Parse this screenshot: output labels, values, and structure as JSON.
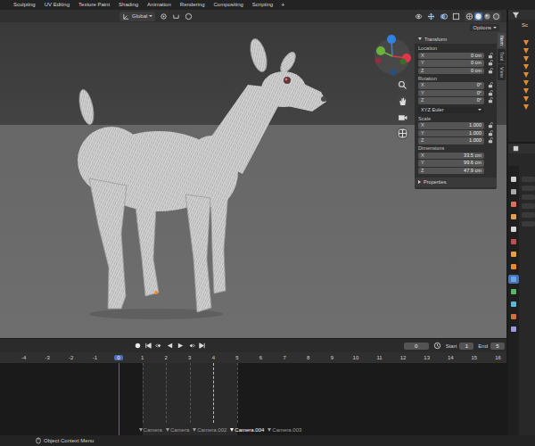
{
  "workspace_tabs": [
    {
      "label": "Sculpting",
      "selected": false
    },
    {
      "label": "UV Editing",
      "selected": false
    },
    {
      "label": "Texture Paint",
      "selected": false
    },
    {
      "label": "Shading",
      "selected": false
    },
    {
      "label": "Animation",
      "selected": false
    },
    {
      "label": "Rendering",
      "selected": false
    },
    {
      "label": "Compositing",
      "selected": false
    },
    {
      "label": "Scripting",
      "selected": false
    }
  ],
  "add_tab": "+",
  "viewport": {
    "orientation": "Global",
    "options": "Options"
  },
  "sidebar_tabs": [
    {
      "label": "Item",
      "selected": true
    },
    {
      "label": "Tool",
      "selected": false
    },
    {
      "label": "View",
      "selected": false
    }
  ],
  "transform": {
    "title": "Transform",
    "expanded": true,
    "sections": [
      {
        "kind": "vector",
        "label": "Location",
        "fields": [
          {
            "axis": "X",
            "value": "0 cm",
            "locked": false
          },
          {
            "axis": "Y",
            "value": "0 cm",
            "locked": false
          },
          {
            "axis": "Z",
            "value": "0 cm",
            "locked": false
          }
        ]
      },
      {
        "kind": "vector",
        "label": "Rotation",
        "fields": [
          {
            "axis": "X",
            "value": "0°",
            "locked": false
          },
          {
            "axis": "Y",
            "value": "0°",
            "locked": false
          },
          {
            "axis": "Z",
            "value": "0°",
            "locked": false
          }
        ]
      },
      {
        "kind": "dropdown",
        "value": "XYZ Euler"
      },
      {
        "kind": "vector",
        "label": "Scale",
        "fields": [
          {
            "axis": "X",
            "value": "1.000",
            "locked": false
          },
          {
            "axis": "Y",
            "value": "1.000",
            "locked": false
          },
          {
            "axis": "Z",
            "value": "1.000",
            "locked": false
          }
        ]
      },
      {
        "kind": "vector",
        "label": "Dimensions",
        "fields": [
          {
            "axis": "X",
            "value": "33.5 cm"
          },
          {
            "axis": "Y",
            "value": "99.6 cm"
          },
          {
            "axis": "Z",
            "value": "47.9 cm"
          }
        ]
      }
    ]
  },
  "properties_panel": {
    "label": "Properties",
    "expanded": false
  },
  "outliner": {
    "label": "Sc"
  },
  "properties_tabs": [
    {
      "selected": false
    },
    {
      "selected": false
    },
    {
      "selected": false
    },
    {
      "selected": false
    },
    {
      "selected": false
    },
    {
      "selected": false
    },
    {
      "selected": false
    },
    {
      "selected": false
    },
    {
      "selected": true
    },
    {
      "selected": false
    },
    {
      "selected": false
    },
    {
      "selected": false
    },
    {
      "selected": false
    }
  ],
  "timeline": {
    "frame": "0",
    "start_label": "Start",
    "start": "1",
    "end_label": "End",
    "end": "5",
    "ruler": [
      {
        "label": "-4",
        "selected": false
      },
      {
        "label": "-3",
        "selected": false
      },
      {
        "label": "-2",
        "selected": false
      },
      {
        "label": "-1",
        "selected": false
      },
      {
        "label": "0",
        "selected": true
      },
      {
        "label": "1",
        "selected": false
      },
      {
        "label": "2",
        "selected": false
      },
      {
        "label": "3",
        "selected": false
      },
      {
        "label": "4",
        "selected": false
      },
      {
        "label": "5",
        "selected": false
      },
      {
        "label": "6",
        "selected": false
      },
      {
        "label": "7",
        "selected": false
      },
      {
        "label": "8",
        "selected": false
      },
      {
        "label": "9",
        "selected": false
      },
      {
        "label": "10",
        "selected": false
      },
      {
        "label": "11",
        "selected": false
      },
      {
        "label": "12",
        "selected": false
      },
      {
        "label": "13",
        "selected": false
      },
      {
        "label": "14",
        "selected": false
      },
      {
        "label": "15",
        "selected": false
      },
      {
        "label": "16",
        "selected": false
      }
    ],
    "markers": [
      {
        "label": "Camera",
        "selected": false
      },
      {
        "label": "Camera",
        "selected": false
      },
      {
        "label": "Camera.002",
        "selected": false
      },
      {
        "label": "Camera.004",
        "selected": true
      },
      {
        "label": "Camera.003",
        "selected": false
      }
    ]
  },
  "status_bar": {
    "text": "Object Context Menu"
  }
}
